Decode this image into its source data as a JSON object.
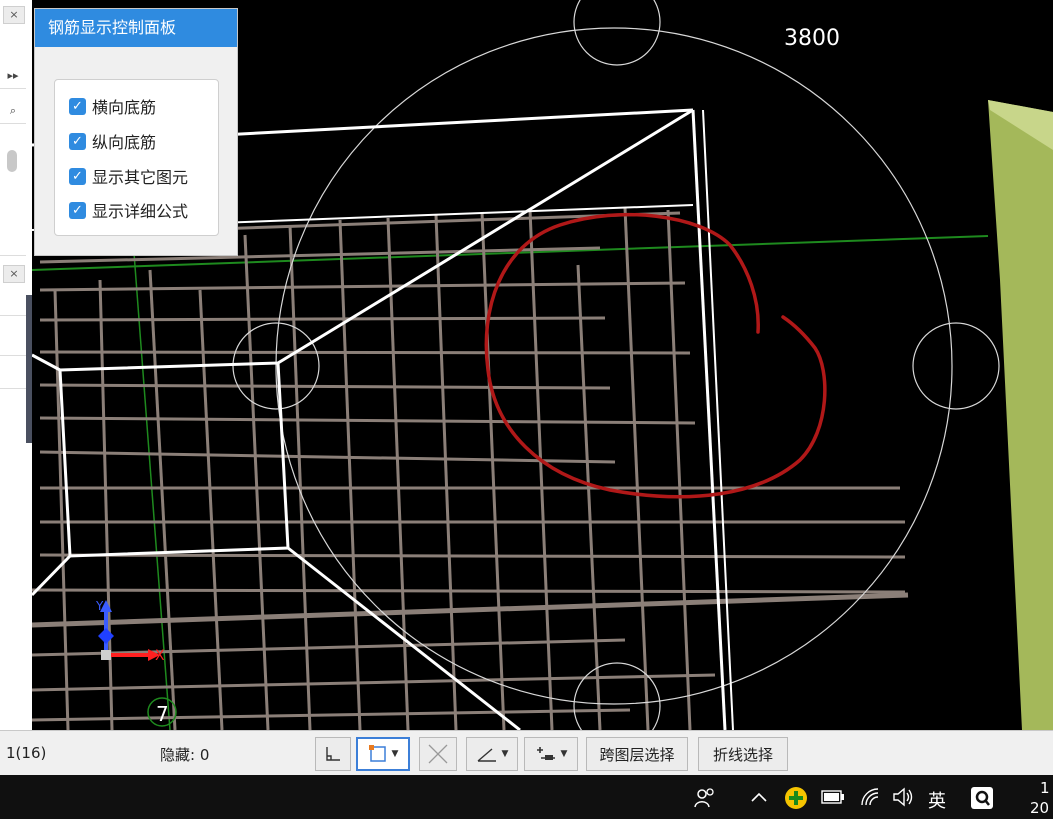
{
  "panel": {
    "title": "钢筋显示控制面板",
    "options": [
      {
        "label": "横向底筋",
        "checked": true
      },
      {
        "label": "纵向底筋",
        "checked": true
      },
      {
        "label": "显示其它图元",
        "checked": true
      },
      {
        "label": "显示详细公式",
        "checked": true
      }
    ]
  },
  "viewport": {
    "dimension_label": "3800",
    "axis_x_label": "X",
    "axis_y_label": "Y",
    "view_number": "7"
  },
  "left_strip": {
    "close_glyph": "×",
    "expand_glyph": "▸▸",
    "search_glyph": "⌕"
  },
  "status": {
    "selection_count": "1(16)",
    "hidden_label": "隐藏: 0",
    "cross_layer_select": "跨图层选择",
    "polyline_select": "折线选择"
  },
  "taskbar": {
    "ime_label": "英",
    "clock_partial_1": "1",
    "clock_partial_2": "20"
  },
  "colors": {
    "panel_header": "#2f8be0",
    "rebar": "#8b7f78",
    "annotation": "#b01818",
    "slab_edge": "#ffffff",
    "green_wall": "#a4b85a"
  }
}
